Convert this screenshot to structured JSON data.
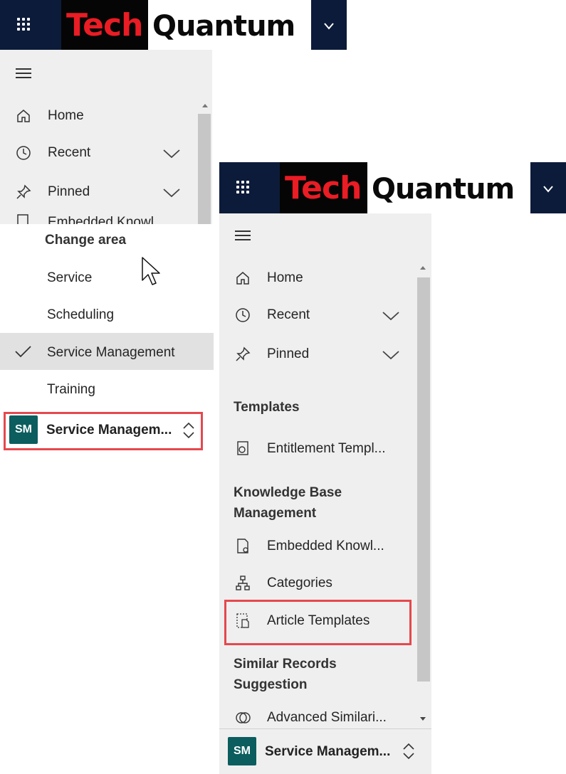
{
  "brand": {
    "tech": "Tech",
    "quantum": "Quantum"
  },
  "left": {
    "nav": [
      {
        "label": "Home",
        "icon": "home-icon"
      },
      {
        "label": "Recent",
        "icon": "clock-icon"
      },
      {
        "label": "Pinned",
        "icon": "pin-icon"
      }
    ],
    "hidden_item": "Embedded Knowl",
    "change_area": {
      "title": "Change area",
      "items": [
        "Service",
        "Scheduling",
        "Service Management",
        "Training"
      ],
      "selected": "Service Management"
    },
    "area_switcher": {
      "badge": "SM",
      "label": "Service Managem..."
    }
  },
  "right": {
    "nav": [
      {
        "label": "Home",
        "icon": "home-icon"
      },
      {
        "label": "Recent",
        "icon": "clock-icon"
      },
      {
        "label": "Pinned",
        "icon": "pin-icon"
      }
    ],
    "sections": [
      {
        "title": "Templates",
        "items": [
          "Entitlement Templ..."
        ]
      },
      {
        "title_lines": [
          "Knowledge Base",
          "Management"
        ],
        "items": [
          "Embedded Knowl...",
          "Categories",
          "Article Templates"
        ]
      },
      {
        "title_lines": [
          "Similar Records",
          "Suggestion"
        ],
        "items": [
          "Advanced Similari..."
        ]
      }
    ],
    "area_switcher": {
      "badge": "SM",
      "label": "Service Managem..."
    }
  },
  "colors": {
    "topbar": "#0d1b3a",
    "accent_red": "#e5484d",
    "badge": "#0b5d5e",
    "panel": "#efefef"
  }
}
